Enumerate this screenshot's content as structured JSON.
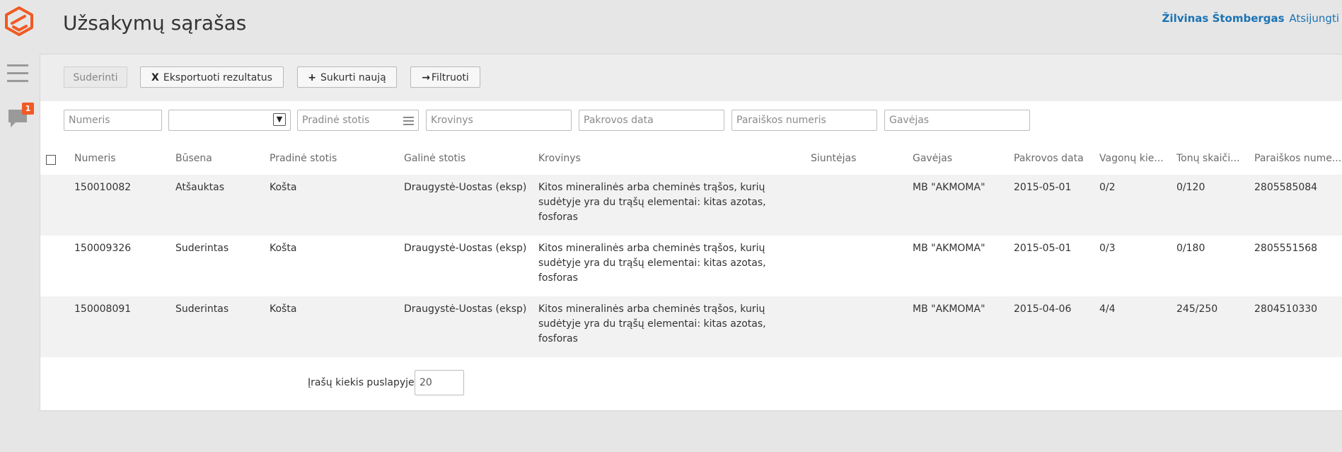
{
  "header": {
    "title": "Užsakymų sąrašas",
    "user_name": "Žilvinas Štombergas",
    "logout": "Atsijungti",
    "brand_color": "#f05a24"
  },
  "sidebar": {
    "menu_icon": "hamburger-icon",
    "comments_icon": "comment-icon",
    "comments_badge": "1"
  },
  "toolbar": {
    "approve_label": "Suderinti",
    "export_label": "Eksportuoti rezultatus",
    "export_icon": "X",
    "create_label": "Sukurti naują",
    "create_icon": "+",
    "filter_label": "Filtruoti",
    "filter_icon": "→"
  },
  "filters": {
    "number": "Numeris",
    "status": "",
    "start_station": "Pradinė stotis",
    "cargo": "Krovinys",
    "loading_date": "Pakrovos data",
    "application_number": "Paraiškos numeris",
    "receiver": "Gavėjas"
  },
  "columns": [
    "Numeris",
    "Būsena",
    "Pradinė stotis",
    "Galinė stotis",
    "Krovinys",
    "Siuntėjas",
    "Gavėjas",
    "Pakrovos data",
    "Vagonų kie...",
    "Tonų skaiči...",
    "Paraiškos nume..."
  ],
  "rows": [
    {
      "number": "150010082",
      "status": "Atšauktas",
      "start": "Košta",
      "end": "Draugystė-Uostas (eksp)",
      "cargo": "Kitos mineralinės arba cheminės trąšos, kurių sudėtyje yra du trąšų elementai: kitas azotas, fosforas",
      "sender": "",
      "receiver": "MB \"AKMOMA\"",
      "date": "2015-05-01",
      "wagons": "0/2",
      "tons": "0/120",
      "application": "2805585084"
    },
    {
      "number": "150009326",
      "status": "Suderintas",
      "start": "Košta",
      "end": "Draugystė-Uostas (eksp)",
      "cargo": "Kitos mineralinės arba cheminės trąšos, kurių sudėtyje yra du trąšų elementai: kitas azotas, fosforas",
      "sender": "",
      "receiver": "MB \"AKMOMA\"",
      "date": "2015-05-01",
      "wagons": "0/3",
      "tons": "0/180",
      "application": "2805551568"
    },
    {
      "number": "150008091",
      "status": "Suderintas",
      "start": "Košta",
      "end": "Draugystė-Uostas (eksp)",
      "cargo": "Kitos mineralinės arba cheminės trąšos, kurių sudėtyje yra du trąšų elementai: kitas azotas, fosforas",
      "sender": "",
      "receiver": "MB \"AKMOMA\"",
      "date": "2015-04-06",
      "wagons": "4/4",
      "tons": "245/250",
      "application": "2804510330"
    }
  ],
  "pager": {
    "label": "Įrašų kiekis puslapyje",
    "value": "20"
  }
}
